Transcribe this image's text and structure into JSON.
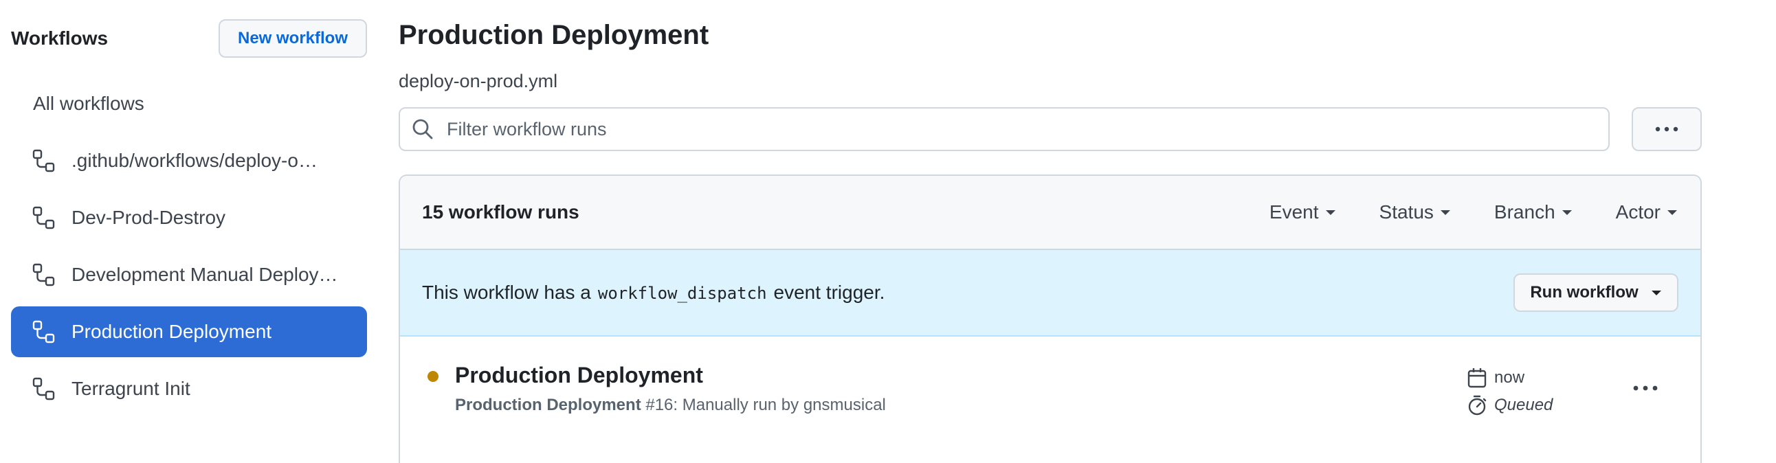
{
  "sidebar": {
    "title": "Workflows",
    "new_workflow_label": "New workflow",
    "all_workflows_label": "All workflows",
    "items": [
      {
        "label": ".github/workflows/deploy-on-dev.yml",
        "icon": "workflow-icon",
        "active": false
      },
      {
        "label": "Dev-Prod-Destroy",
        "icon": "workflow-icon",
        "active": false
      },
      {
        "label": "Development Manual Deployment",
        "icon": "workflow-icon",
        "active": false
      },
      {
        "label": "Production Deployment",
        "icon": "workflow-icon",
        "active": true
      },
      {
        "label": "Terragrunt Init",
        "icon": "workflow-icon",
        "active": false
      }
    ]
  },
  "main": {
    "title": "Production Deployment",
    "subtitle": "deploy-on-prod.yml",
    "search": {
      "placeholder": "Filter workflow runs",
      "icon": "search-icon"
    },
    "more_icon": "kebab-horizontal-icon",
    "runs": {
      "count_label": "15 workflow runs",
      "filters": [
        "Event",
        "Status",
        "Branch",
        "Actor"
      ],
      "dispatch": {
        "text_before": "This workflow has a",
        "code": "workflow_dispatch",
        "text_after": "event trigger.",
        "button_label": "Run workflow"
      },
      "items": [
        {
          "title": "Production Deployment",
          "workflow": "Production Deployment",
          "meta": "#16: Manually run by gnsmusical",
          "time": "now",
          "status": "Queued",
          "status_color": "#bf8700"
        }
      ]
    }
  },
  "colors": {
    "accent": "#0969da",
    "active_nav": "#2d6bd5",
    "banner": "#ddf4ff",
    "queued": "#bf8700"
  }
}
